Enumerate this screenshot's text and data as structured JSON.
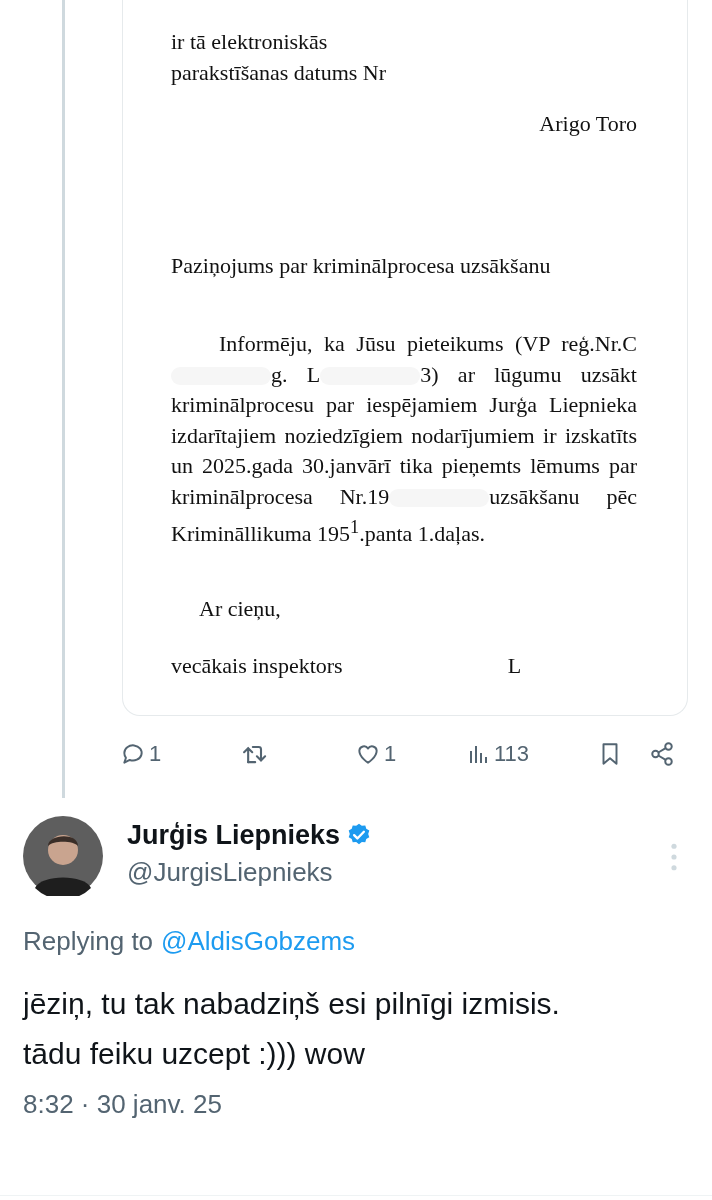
{
  "attachment": {
    "kind": "document",
    "header_lines": [
      "ir tā elektroniskās",
      "parakstīšanas datums Nr"
    ],
    "signer": "Arigo Toro",
    "title": "Paziņojums par kriminālprocesa uzsākšanu",
    "body_parts": [
      {
        "kind": "text",
        "text": "Informēju, ka Jūsu pieteikums (VP reģ.Nr.C"
      },
      {
        "kind": "redacted"
      },
      {
        "kind": "text",
        "text": "g. L"
      },
      {
        "kind": "redacted"
      },
      {
        "kind": "text",
        "text": "3) ar lūgumu uzsākt kriminālprocesu par iespējamiem Jurģa Liepnieka izdarītajiem noziedzīgiem nodarījumiem ir izskatīts un 2025.gada 30.janvārī tika pieņemts lēmums par kriminālprocesa Nr.19"
      },
      {
        "kind": "redacted"
      },
      {
        "kind": "text",
        "text": "uzsākšanu pēc Krimināllikuma 195$^{1}$.panta 1.daļas."
      }
    ],
    "closing": "Ar cieņu,",
    "signature_role": "vecākais inspektors",
    "signature_initial": "L"
  },
  "actions": [
    {
      "kind": "reply",
      "count": "1"
    },
    {
      "kind": "repost"
    },
    {
      "kind": "like",
      "count": "1"
    },
    {
      "kind": "views",
      "count": "113"
    },
    {
      "kind": "bookmark"
    },
    {
      "kind": "share"
    }
  ],
  "reply": {
    "author": "Jurģis Liepnieks",
    "verified": true,
    "handle": "@JurgisLiepnieks",
    "replying_label": "Replying to",
    "replying_to": "@AldisGobzems",
    "text": "jēziņ, tu tak nabadziņš esi pilnīgi izmisis. tādu feiku uzcept :))) wow",
    "time": "8:32 · 30 janv. 25"
  }
}
